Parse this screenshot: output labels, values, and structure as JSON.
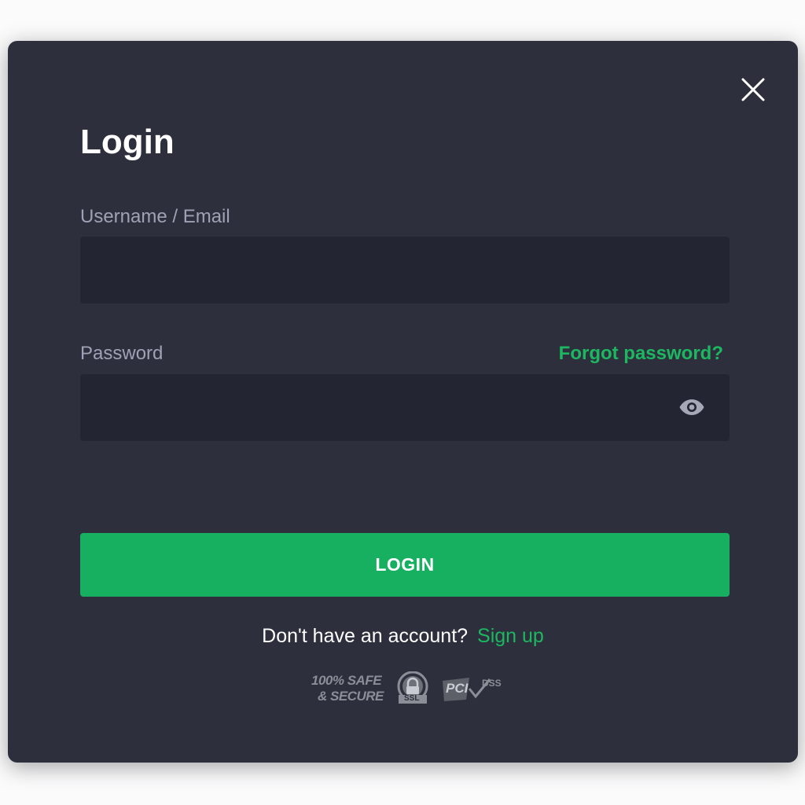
{
  "dialog": {
    "title": "Login",
    "close_icon": "close-icon"
  },
  "form": {
    "username": {
      "label": "Username / Email",
      "value": "",
      "placeholder": ""
    },
    "password": {
      "label": "Password",
      "value": "",
      "placeholder": "",
      "toggle_icon": "eye-icon"
    },
    "forgot_password_label": "Forgot password?",
    "submit_label": "LOGIN"
  },
  "signup": {
    "prompt": "Don't have an account?",
    "link_label": "Sign up"
  },
  "badges": {
    "safe_line1": "100% SAFE",
    "safe_line2": "& SECURE",
    "ssl": "SSL",
    "pci": "PCI",
    "dss": "DSS"
  },
  "colors": {
    "modal_bg": "#2d2f3c",
    "input_bg": "#242532",
    "accent": "#17b060",
    "link": "#1db761",
    "label": "#9fa2b6"
  }
}
